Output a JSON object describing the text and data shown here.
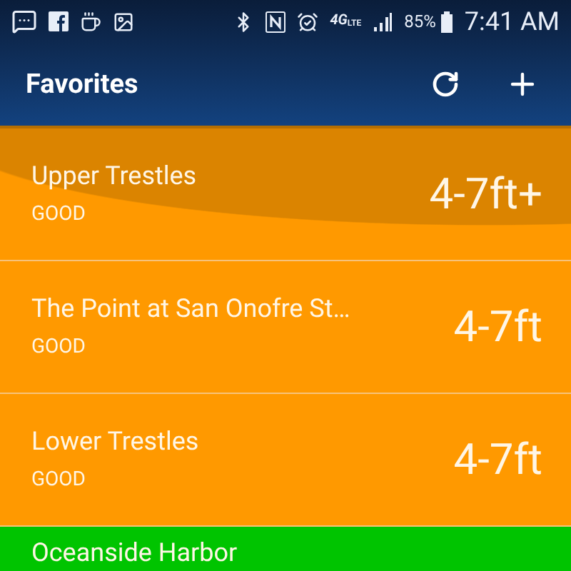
{
  "status_bar": {
    "network": "4G",
    "network_sub": "LTE",
    "battery": "85%",
    "time": "7:41 AM"
  },
  "app_bar": {
    "title": "Favorites"
  },
  "spots": [
    {
      "name": "Upper Trestles",
      "rating": "GOOD",
      "height": "4-7ft+",
      "color": "#ff9900"
    },
    {
      "name": "The Point at San Onofre St…",
      "rating": "GOOD",
      "height": "4-7ft",
      "color": "#ff9900"
    },
    {
      "name": "Lower Trestles",
      "rating": "GOOD",
      "height": "4-7ft",
      "color": "#ff9900"
    },
    {
      "name": "Oceanside Harbor",
      "color": "#00c400"
    }
  ]
}
